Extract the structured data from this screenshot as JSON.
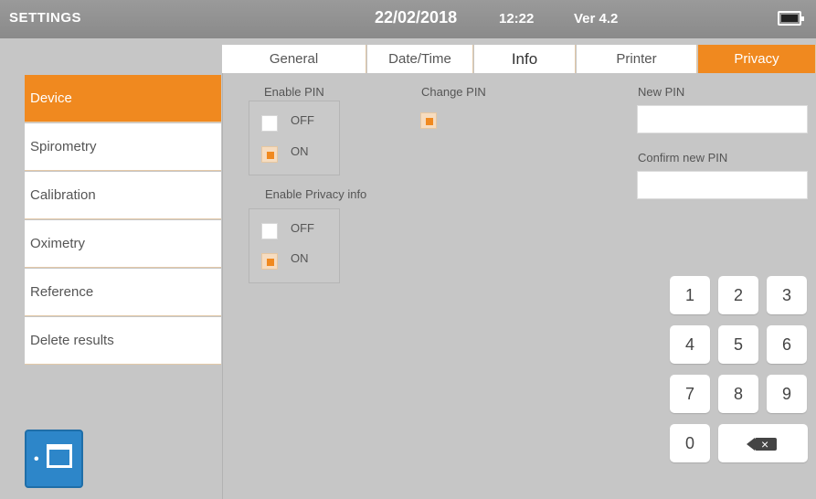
{
  "topbar": {
    "title": "SETTINGS",
    "date": "22/02/2018",
    "time": "12:22",
    "version": "Ver 4.2"
  },
  "sidebar": {
    "items": [
      {
        "label": "Device",
        "active": true
      },
      {
        "label": "Spirometry",
        "active": false
      },
      {
        "label": "Calibration",
        "active": false
      },
      {
        "label": "Oximetry",
        "active": false
      },
      {
        "label": "Reference",
        "active": false
      },
      {
        "label": "Delete  results",
        "active": false
      }
    ]
  },
  "tabs": [
    {
      "label": "General",
      "active": false
    },
    {
      "label": "Date/Time",
      "active": false
    },
    {
      "label": "Info",
      "active": false
    },
    {
      "label": "Printer",
      "active": false
    },
    {
      "label": "Privacy",
      "active": true
    }
  ],
  "privacy": {
    "enable_pin": {
      "label": "Enable PIN",
      "off_label": "OFF",
      "on_label": "ON",
      "selected": "ON"
    },
    "change_pin": {
      "label": "Change PIN",
      "checked": true
    },
    "enable_privacy_info": {
      "label": "Enable Privacy info",
      "off_label": "OFF",
      "on_label": "ON",
      "selected": "ON"
    },
    "new_pin": {
      "label": "New PIN",
      "value": ""
    },
    "confirm_pin": {
      "label": "Confirm new  PIN",
      "value": ""
    }
  },
  "keypad": {
    "keys": [
      "1",
      "2",
      "3",
      "4",
      "5",
      "6",
      "7",
      "8",
      "9",
      "0"
    ]
  },
  "colors": {
    "accent": "#f0891f",
    "background": "#c6c6c6",
    "home_button": "#2d86c9"
  }
}
